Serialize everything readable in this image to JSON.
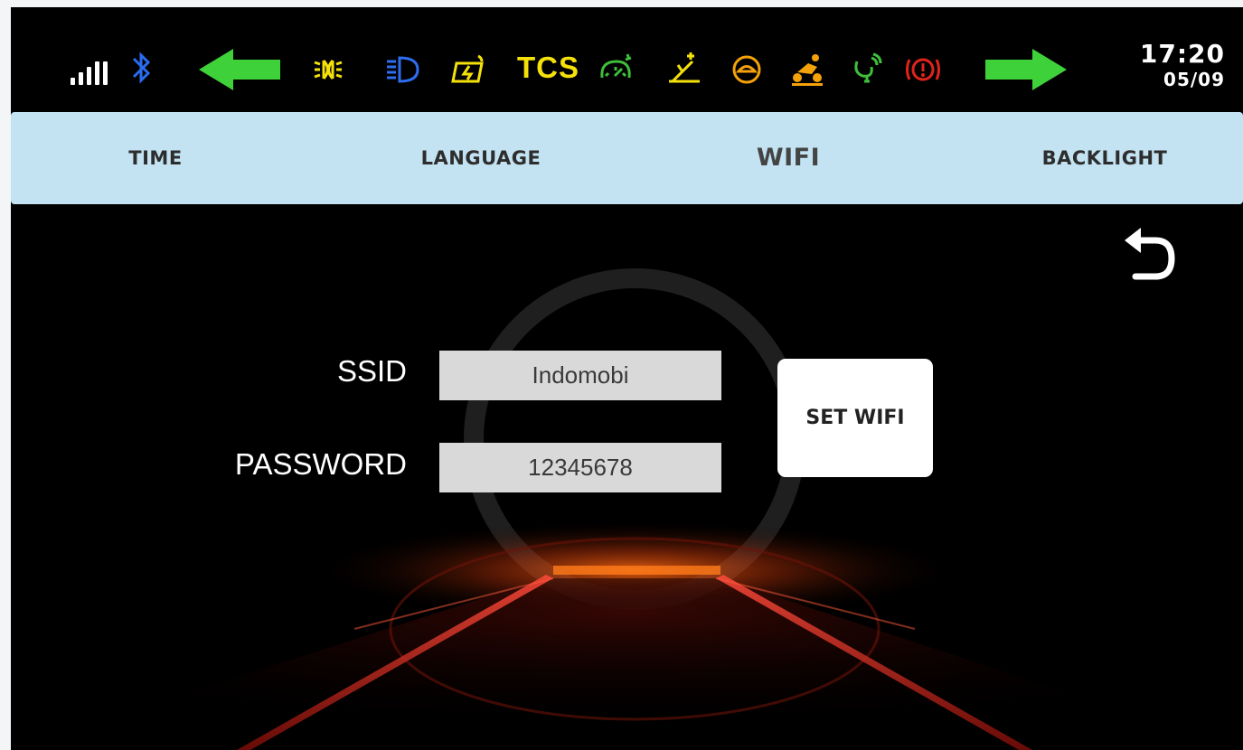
{
  "status_bar": {
    "signal_icon": "signal-bars-icon",
    "bluetooth_icon": "bluetooth-icon",
    "left_turn_icon": "turn-signal-left-icon",
    "right_turn_icon": "turn-signal-right-icon",
    "indicators": [
      {
        "name": "position-light-icon",
        "color": "#f5e10a"
      },
      {
        "name": "high-beam-icon",
        "color": "#2f6df0"
      },
      {
        "name": "battery-charge-warning-icon",
        "color": "#f5e10a"
      },
      {
        "name": "traction-control-label",
        "text": "TCS",
        "color": "#f5e10a"
      },
      {
        "name": "speedometer-warning-icon",
        "color": "#3fbf3a"
      },
      {
        "name": "side-stand-icon",
        "color": "#f5e10a"
      },
      {
        "name": "eco-mode-icon",
        "color": "#f5a20a"
      },
      {
        "name": "rider-mode-icon",
        "color": "#f5a20a"
      },
      {
        "name": "gps-signal-icon",
        "color": "#3fbf3a"
      },
      {
        "name": "brake-warning-icon",
        "color": "#e0231b"
      }
    ],
    "turn_signal_color": "#3fd13a",
    "clock": {
      "time": "17:20",
      "date": "05/09"
    }
  },
  "tabs": [
    {
      "id": "time",
      "label": "TIME"
    },
    {
      "id": "language",
      "label": "LANGUAGE"
    },
    {
      "id": "wifi",
      "label": "WIFI",
      "active": true
    },
    {
      "id": "backlight",
      "label": "BACKLIGHT"
    }
  ],
  "tab_bar_color": "#c3e3f3",
  "back_icon": "back-arrow-icon",
  "wifi_form": {
    "ssid_label": "SSID",
    "ssid_value": "Indomobi",
    "password_label": "PASSWORD",
    "password_value": "12345678",
    "submit_label": "SET WIFI"
  }
}
